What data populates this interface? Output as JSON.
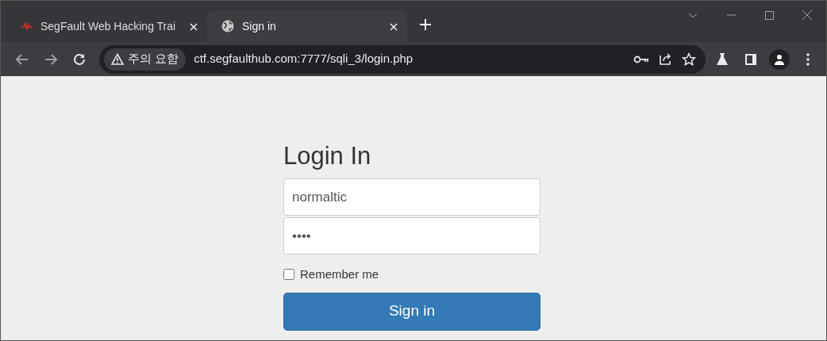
{
  "tabs": [
    {
      "title": "SegFault Web Hacking Trai",
      "kind": "site",
      "selected": false
    },
    {
      "title": "Sign in",
      "kind": "globe",
      "selected": true
    }
  ],
  "address_bar": {
    "security_label": "주의 요함",
    "url": "ctf.segfaulthub.com:7777/sqli_3/login.php"
  },
  "form": {
    "heading": "Login In",
    "username": "normaltic",
    "password": "••••",
    "remember": {
      "label": "Remember me",
      "checked": false
    },
    "submit": "Sign in"
  }
}
